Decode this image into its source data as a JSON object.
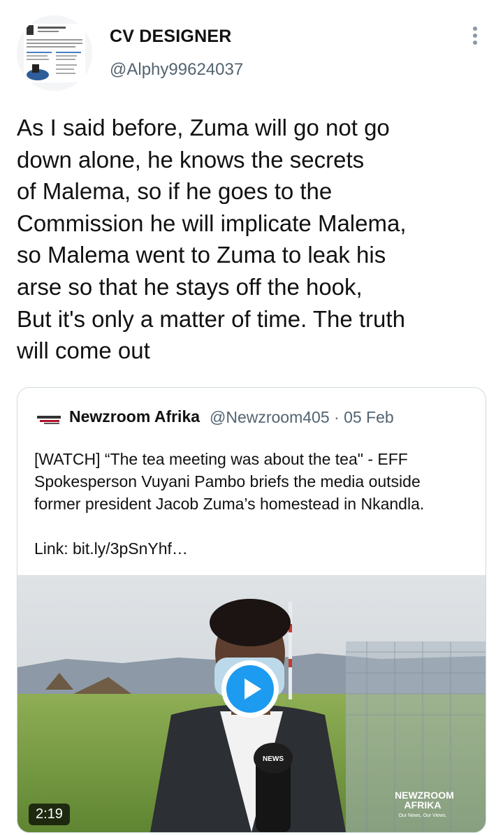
{
  "tweet": {
    "display_name": "CV DESIGNER",
    "handle": "@Alphy99624037",
    "text": "As I said before, Zuma will go not go\ndown alone, he knows the secrets\nof Malema, so if he goes to the\nCommission he will implicate Malema,\nso Malema went to Zuma to leak his\narse so that he stays off the hook,\nBut it's only a matter of time. The truth\nwill come out",
    "more_icon": "vertical-ellipsis-icon",
    "avatar_icon": "cv-document-avatar"
  },
  "quoted_tweet": {
    "display_name": "Newzroom Afrika",
    "handle_and_date": "@Newzroom405 · 05 Feb",
    "text": "[WATCH] “The tea meeting was about the tea\" - EFF\nSpokesperson Vuyani Pambo briefs the media outside\nformer president Jacob Zuma’s homestead in Nkandla.\n\nLink: bit.ly/3pSnYhf…",
    "logo_icon": "newzroom-afrika-logo",
    "video": {
      "duration": "2:19",
      "play_icon": "play-icon",
      "watermark_line1": "NEWZROOM",
      "watermark_line2": "AFRIKA",
      "watermark_tagline": "Our News, Our Views.",
      "mic_label": "NEWS"
    }
  },
  "colors": {
    "accent": "#1d9bf0",
    "secondary_text": "#536471",
    "border": "#cfd9de"
  }
}
